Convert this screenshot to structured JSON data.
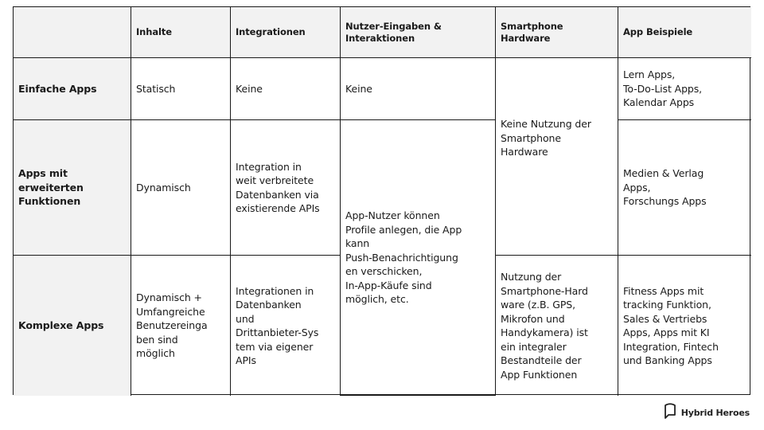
{
  "table": {
    "headers": [
      "",
      "Inhalte",
      "Integrationen",
      "Nutzer-Eingaben &\nInteraktionen",
      "Smartphone\nHardware",
      "App Beispiele"
    ],
    "rows": [
      {
        "label": "Einfache Apps",
        "inhalte": "Statisch",
        "integrationen": "Keine",
        "nutzer_eingaben": "Keine",
        "app_beispiele": "Lern Apps,\nTo-Do-List Apps,\nKalendar Apps"
      },
      {
        "label": "Apps mit\nerweiterten\nFunktionen",
        "inhalte": "Dynamisch",
        "integrationen": "Integration in\nweit verbreitete\nDatenbanken via\nexistierende APIs",
        "app_beispiele": "Medien & Verlag\nApps,\nForschungs Apps"
      },
      {
        "label": "Komplexe Apps",
        "inhalte": "Dynamisch +\nUmfangreiche\nBenutzereinga\nben sind\nmöglich",
        "integrationen": "Integrationen in\nDatenbanken\nund\nDrittanbieter-Sys\ntem via eigener\nAPIs",
        "smartphone_hardware": "Nutzung der\nSmartphone-Hard\nware (z.B. GPS,\nMikrofon und\nHandykamera) ist\nein integraler\nBestandteile der\nApp Funktionen",
        "app_beispiele": "Fitness Apps mit\ntracking Funktion,\nSales & Vertriebs\nApps, Apps mit KI\nIntegration, Fintech\nund Banking Apps"
      }
    ],
    "merged": {
      "nutzer_eingaben_rows_2_3": "App-Nutzer können\nProfile anlegen, die App\nkann\nPush-Benachrichtigung\nen verschicken,\nIn-App-Käufe sind\nmöglich, etc.",
      "smartphone_hardware_rows_1_2": "Keine Nutzung der\nSmartphone\nHardware"
    }
  },
  "logo": {
    "icon": "speech-bubble-shield-icon",
    "text": "Hybrid Heroes"
  }
}
